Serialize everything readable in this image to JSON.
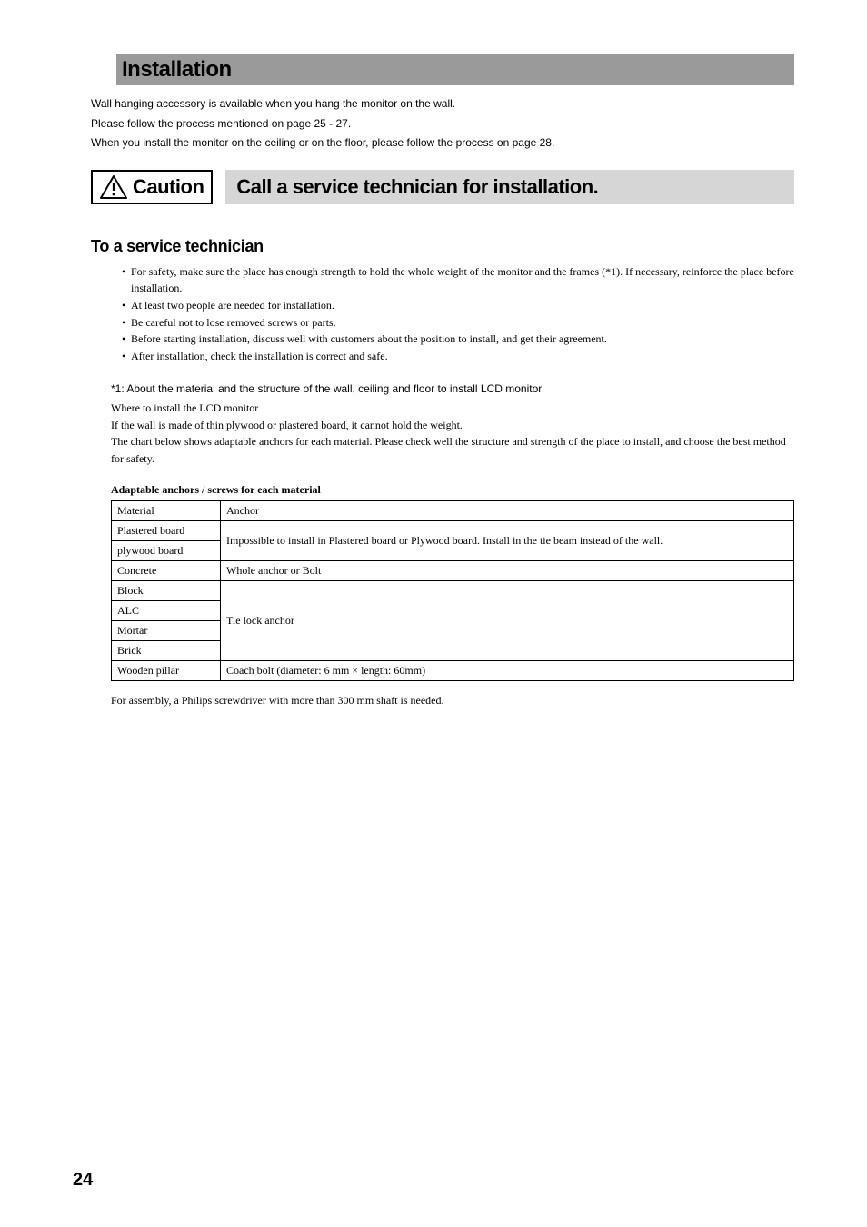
{
  "title": "Installation",
  "intro": {
    "line1": "Wall hanging accessory is available when you hang the monitor on the wall.",
    "line2": "Please follow the process mentioned on page 25 - 27.",
    "line3": "When you install the monitor on the ceiling or on the floor, please follow the process on page 28."
  },
  "caution": {
    "label": "Caution",
    "banner": "Call a service technician for installation."
  },
  "section_heading": "To a service technician",
  "bullets": [
    "For safety,  make sure the place has enough strength to hold the whole weight of the monitor and the frames (*1). If necessary, reinforce the place before installation.",
    "At least two people are needed for installation.",
    "Be careful  not to lose removed screws or parts.",
    "Before starting installation, discuss well with customers about the position to install, and get their agreement.",
    "After installation, check the installation is correct and safe."
  ],
  "note": {
    "head": "*1: About the material and the structure of the wall, ceiling and floor to install LCD monitor",
    "line1": "Where to install the LCD monitor",
    "line2": "If the wall is made of thin plywood or plastered board, it cannot hold the weight.",
    "line3": "The chart below shows adaptable anchors for each material. Please check well the structure and strength of the place to install, and choose the best method for safety."
  },
  "table": {
    "caption": "Adaptable anchors / screws for each material",
    "header": {
      "col1": "Material",
      "col2": "Anchor"
    },
    "rows": {
      "plastered": "Plastered board",
      "plywood": "plywood board",
      "plastered_anchor": "Impossible to install in Plastered board or Plywood board.  Install in the tie beam instead of the wall.",
      "concrete": "Concrete",
      "concrete_anchor": "Whole anchor or Bolt",
      "block": "Block",
      "alc": "ALC",
      "mortar": "Mortar",
      "brick": "Brick",
      "block_anchor": "Tie lock anchor",
      "wooden": "Wooden pillar",
      "wooden_anchor": "Coach bolt (diameter: 6 mm × length: 60mm)"
    }
  },
  "after_table": "For assembly, a Philips screwdriver with more than 300 mm shaft is needed.",
  "page_number": "24"
}
